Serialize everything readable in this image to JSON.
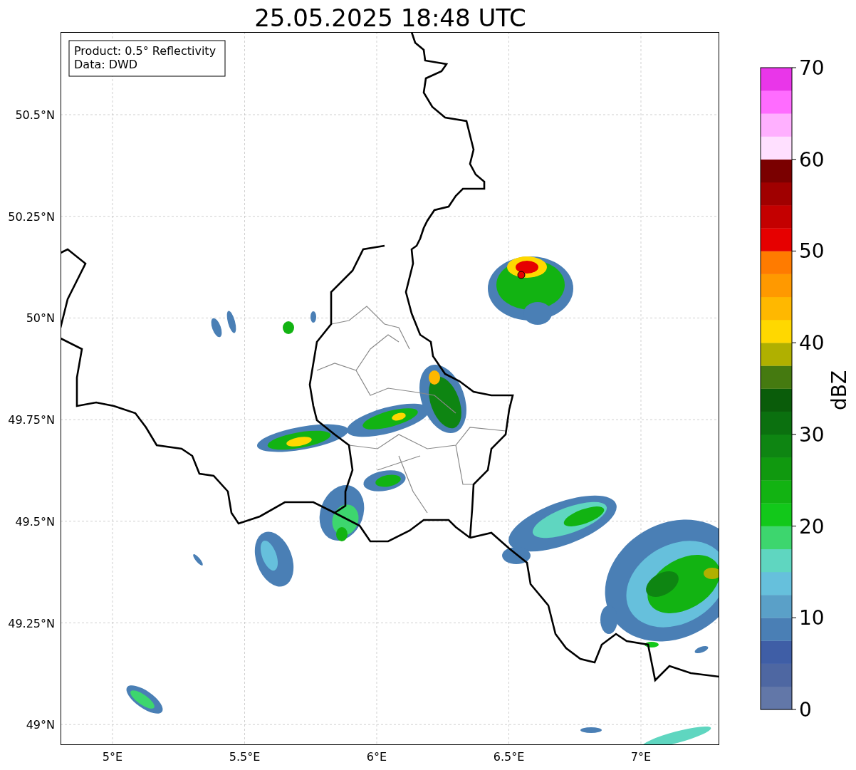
{
  "title": "25.05.2025 18:48 UTC",
  "info_box": [
    "Product: 0.5° Reflectivity",
    "Data: DWD"
  ],
  "map": {
    "x_tick_labels": [
      "5°E",
      "5.5°E",
      "6°E",
      "6.5°E",
      "7°E"
    ],
    "y_tick_labels": [
      "50.5°N",
      "50.25°N",
      "50°N",
      "49.75°N",
      "49.5°N",
      "49.25°N",
      "49°N"
    ]
  },
  "colorbar": {
    "label": "dBZ",
    "tick_labels": [
      "70",
      "60",
      "50",
      "40",
      "30",
      "20",
      "10",
      "0"
    ],
    "segments": [
      {
        "color": "#6277a8"
      },
      {
        "color": "#4e67a2"
      },
      {
        "color": "#3f5ea6"
      },
      {
        "color": "#4a7fb5"
      },
      {
        "color": "#5aa0c8"
      },
      {
        "color": "#66c0dc"
      },
      {
        "color": "#5fd6c0"
      },
      {
        "color": "#3dd66e"
      },
      {
        "color": "#12c81a"
      },
      {
        "color": "#12b312"
      },
      {
        "color": "#10990f"
      },
      {
        "color": "#0e8512"
      },
      {
        "color": "#0b700f"
      },
      {
        "color": "#0a5c0a"
      },
      {
        "color": "#457a10"
      },
      {
        "color": "#b0b000"
      },
      {
        "color": "#ffd800"
      },
      {
        "color": "#ffb800"
      },
      {
        "color": "#ff9900"
      },
      {
        "color": "#ff7b00"
      },
      {
        "color": "#e60000"
      },
      {
        "color": "#c40000"
      },
      {
        "color": "#a00000"
      },
      {
        "color": "#7a0000"
      },
      {
        "color": "#ffe0ff"
      },
      {
        "color": "#ffb0ff"
      },
      {
        "color": "#ff6cff"
      },
      {
        "color": "#e936e9"
      }
    ]
  }
}
